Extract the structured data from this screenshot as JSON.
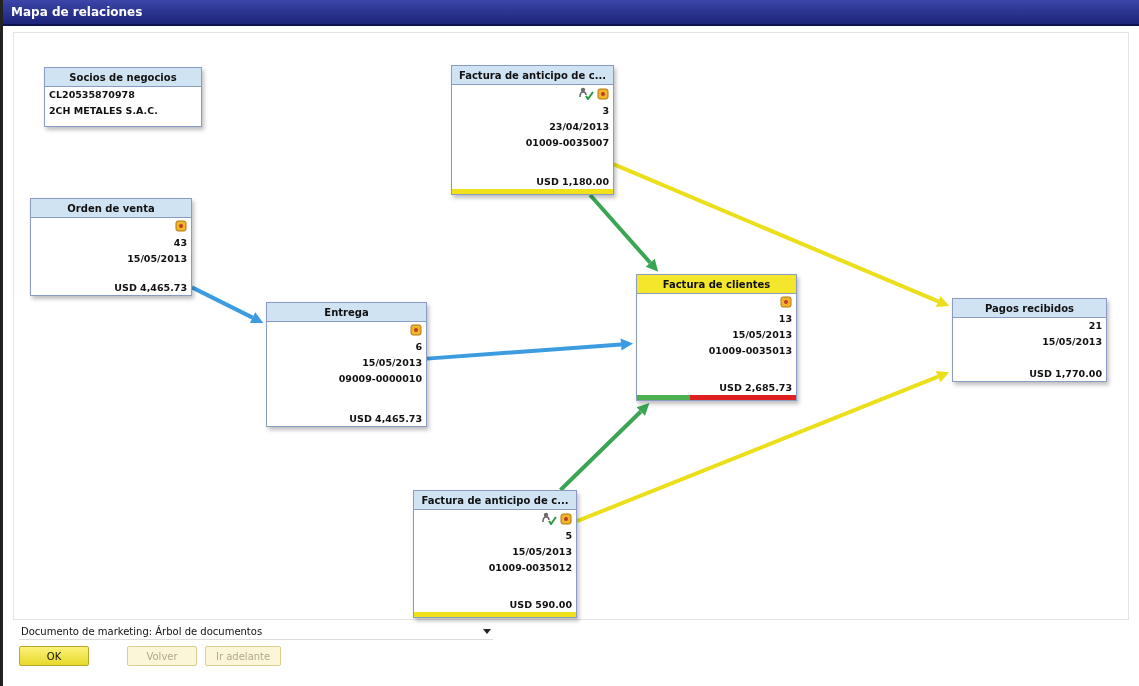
{
  "window": {
    "title": "Mapa de relaciones"
  },
  "nodes": [
    {
      "kind": "partner",
      "title": "Socios de negocios",
      "selected": false,
      "icon_doc": false,
      "icon_check": false,
      "rows": [
        "CL20535870978",
        "2CH METALES S.A.C."
      ]
    },
    {
      "kind": "document",
      "title": "Orden de venta",
      "selected": false,
      "icon_doc": true,
      "icon_check": false,
      "rows": [
        "43",
        "15/05/2013",
        "USD 4,465.73"
      ]
    },
    {
      "kind": "document",
      "title": "Factura de anticipo de c...",
      "selected": false,
      "icon_doc": true,
      "icon_check": true,
      "rows": [
        "3",
        "23/04/2013",
        "01009-0035007",
        "USD 1,180.00"
      ],
      "bars": [
        {
          "color": "#f2e01a"
        }
      ]
    },
    {
      "kind": "document",
      "title": "Entrega",
      "selected": false,
      "icon_doc": true,
      "icon_check": false,
      "rows": [
        "6",
        "15/05/2013",
        "09009-0000010",
        "USD 4,465.73"
      ]
    },
    {
      "kind": "document",
      "title": "Factura de clientes",
      "selected": true,
      "icon_doc": true,
      "icon_check": false,
      "rows": [
        "13",
        "15/05/2013",
        "01009-0035013",
        "USD 2,685.73"
      ],
      "bars": [
        {
          "color": "#4caf50"
        },
        {
          "color": "#e02020"
        },
        {
          "color": "#e02020"
        }
      ]
    },
    {
      "kind": "document",
      "title": "Pagos recibidos",
      "selected": false,
      "icon_doc": false,
      "icon_check": false,
      "rows": [
        "21",
        "15/05/2013",
        "USD 1,770.00"
      ]
    },
    {
      "kind": "document",
      "title": "Factura de anticipo de c...",
      "selected": false,
      "icon_doc": true,
      "icon_check": true,
      "rows": [
        "5",
        "15/05/2013",
        "01009-0035012",
        "USD 590.00"
      ],
      "bars": [
        {
          "color": "#f2e01a"
        }
      ]
    }
  ],
  "links": [
    {
      "color": "#3d9be0"
    },
    {
      "color": "#3d9be0"
    },
    {
      "color": "#3aa655"
    },
    {
      "color": "#3aa655"
    },
    {
      "color": "#eadf1a"
    },
    {
      "color": "#eadf1a"
    }
  ],
  "view_selector": {
    "value": "Documento de marketing: Árbol de documentos"
  },
  "buttons": [
    {
      "label": "OK",
      "disabled": false
    },
    {
      "label": "Volver",
      "disabled": true
    },
    {
      "label": "Ir adelante",
      "disabled": true
    }
  ]
}
